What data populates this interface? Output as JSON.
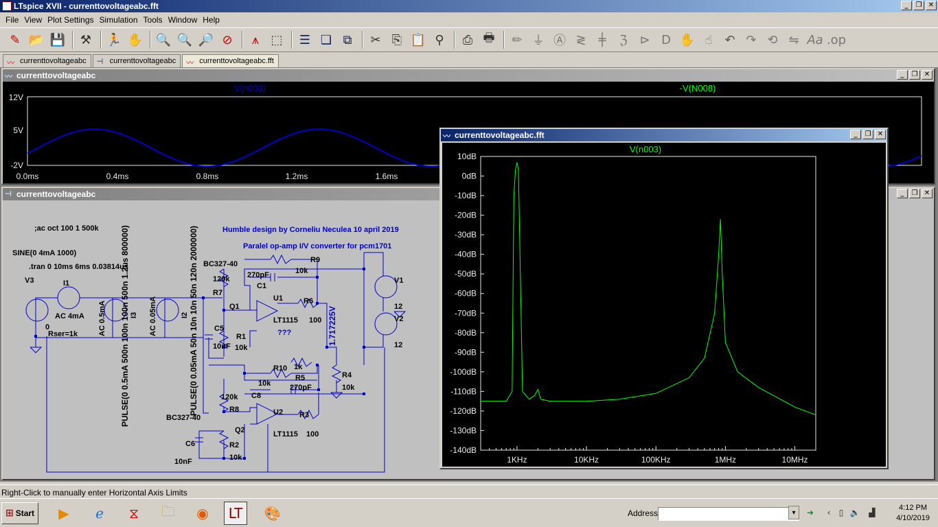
{
  "app": {
    "title": "LTspice XVII - currenttovoltageabc.fft",
    "window_buttons": [
      "_",
      "❐",
      "✕"
    ]
  },
  "menu": [
    "File",
    "View",
    "Plot Settings",
    "Simulation",
    "Tools",
    "Window",
    "Help"
  ],
  "toolbar_icons": [
    "new-schematic-icon",
    "open-icon",
    "save-icon",
    "control-panel-icon",
    "run-icon",
    "halt-icon",
    "zoom-in-icon",
    "zoom-out-icon",
    "zoom-fit-icon",
    "zoom-cancel-icon",
    "autorange-icon",
    "plot-settings-icon",
    "tile-icon",
    "cascade-icon",
    "close-all-icon",
    "cut-icon",
    "copy-icon",
    "paste-icon",
    "find-icon",
    "print-preview-icon",
    "print-icon",
    "wire-icon",
    "ground-icon",
    "label-icon",
    "resistor-icon",
    "capacitor-icon",
    "inductor-icon",
    "diode-icon",
    "component-icon",
    "move-icon",
    "drag-icon",
    "undo-icon",
    "redo-icon",
    "rotate-icon",
    "mirror-icon",
    "text-icon",
    "spice-directive-icon"
  ],
  "tabs": [
    {
      "label": "currenttovoltageabc",
      "icon": "waveform-icon"
    },
    {
      "label": "currenttovoltageabc",
      "icon": "schematic-icon"
    },
    {
      "label": "currenttovoltageabc.fft",
      "icon": "waveform-icon"
    }
  ],
  "transient_window": {
    "title": "currenttovoltageabc",
    "trace_labels": [
      "V(n003)",
      "-V(N008)"
    ],
    "y_ticks": [
      "12V",
      "5V",
      "-2V"
    ],
    "x_ticks": [
      "0.0ms",
      "0.4ms",
      "0.8ms",
      "1.2ms",
      "1.6ms"
    ],
    "trace_color": "#0000cc",
    "label2_color": "#00ff00"
  },
  "schematic_window": {
    "title": "currenttovoltageabc",
    "texts": {
      "ac_oct": ";ac oct 100 1 500k",
      "sine": "SINE(0 4mA 1000)",
      "tran": ".tran 0 10ms 6ms 0.03814us",
      "v3": "V3",
      "i1": "I1",
      "ac4": "AC 4mA",
      "zero": "0",
      "rser": "Rser=1k",
      "ac05": "AC 0.5mA",
      "ac005": "AC 0.05mA",
      "i3": "I3",
      "i2": "I2",
      "pulse1": "PULSE(0 0.5mA 500n 100n 100n 500n 1.2us 800000)",
      "pulse2": "PULSE(0 0.05mA 50n 10n 10n 50n 120n 2000000)",
      "humble": "Humble design by Corneliu Neculea 10 april 2019",
      "paralel": "Paralel op-amp I/V converter  for pcm1701",
      "bc1": "BC327-40",
      "bc2": "BC327-40",
      "r7v": "120k",
      "r7": "R7",
      "q1": "Q1",
      "c5": "C5",
      "c5v": "10nF",
      "r1": "R1",
      "r1v": "10k",
      "c1v": "270pF",
      "c1": "C1",
      "r9": "R9",
      "r9v": "10k",
      "u1": "U1",
      "u1v": "LT1115",
      "r6": "R6",
      "r6v": "100",
      "qqq": "???",
      "node": "1.717225V",
      "v1": "V1",
      "v1v": "12",
      "v2": "V2",
      "v2v": "12",
      "r10": "R10",
      "r10v": "1k",
      "r5v": "10k",
      "r5": "R5",
      "c2v": "270pF",
      "r4": "R4",
      "r4v": "10k",
      "r8v": "120k",
      "c8": "C8",
      "r8": "R8",
      "q2": "Q2",
      "u2": "U2",
      "u2v": "LT1115",
      "r3": "R3",
      "r3v": "100",
      "c6": "C6",
      "c6v": "10nF",
      "r2": "R2",
      "r2v": "10k"
    }
  },
  "fft_window": {
    "title": "currenttovoltageabc.fft",
    "trace_label": "V(n003)",
    "trace_color": "#00ff00",
    "y_ticks": [
      "10dB",
      "0dB",
      "-10dB",
      "-20dB",
      "-30dB",
      "-40dB",
      "-50dB",
      "-60dB",
      "-70dB",
      "-80dB",
      "-90dB",
      "-100dB",
      "-110dB",
      "-120dB",
      "-130dB",
      "-140dB"
    ],
    "x_ticks": [
      "1KHz",
      "10KHz",
      "100KHz",
      "1MHz",
      "10MHz"
    ]
  },
  "chart_data": [
    {
      "type": "line",
      "xlabel": "",
      "ylabel": "",
      "x_range_ms": [
        0.0,
        1.8
      ],
      "ylim": [
        -2,
        12
      ],
      "series": [
        {
          "name": "V(n003)",
          "frequency_hz": 1000,
          "offset_v": 1.6,
          "amplitude_v": 3.8
        }
      ]
    },
    {
      "type": "line",
      "xlabel": "",
      "ylabel": "",
      "xscale": "log",
      "xlim_hz": [
        300,
        20000000
      ],
      "ylim": [
        -140,
        10
      ],
      "series": [
        {
          "name": "V(n003)",
          "x": [
            300,
            700,
            850,
            900,
            950,
            1000,
            1050,
            1200,
            1500,
            1800,
            2000,
            2200,
            3000,
            10000,
            30000,
            100000,
            300000,
            500000,
            700000,
            800000,
            850000,
            900000,
            1000000,
            1500000,
            3000000,
            10000000,
            20000000
          ],
          "y": [
            -115,
            -115,
            -110,
            -10,
            3,
            7,
            3,
            -110,
            -114,
            -112,
            -109,
            -114,
            -115,
            -115,
            -114,
            -111,
            -103,
            -93,
            -70,
            -40,
            -22,
            -50,
            -85,
            -100,
            -108,
            -118,
            -122
          ]
        }
      ]
    }
  ],
  "status": {
    "text": "Right-Click to manually enter Horizontal Axis Limits"
  },
  "taskbar": {
    "start_label": "Start",
    "address_label": "Address",
    "clock_time": "4:12 PM",
    "clock_date": "4/10/2019"
  }
}
